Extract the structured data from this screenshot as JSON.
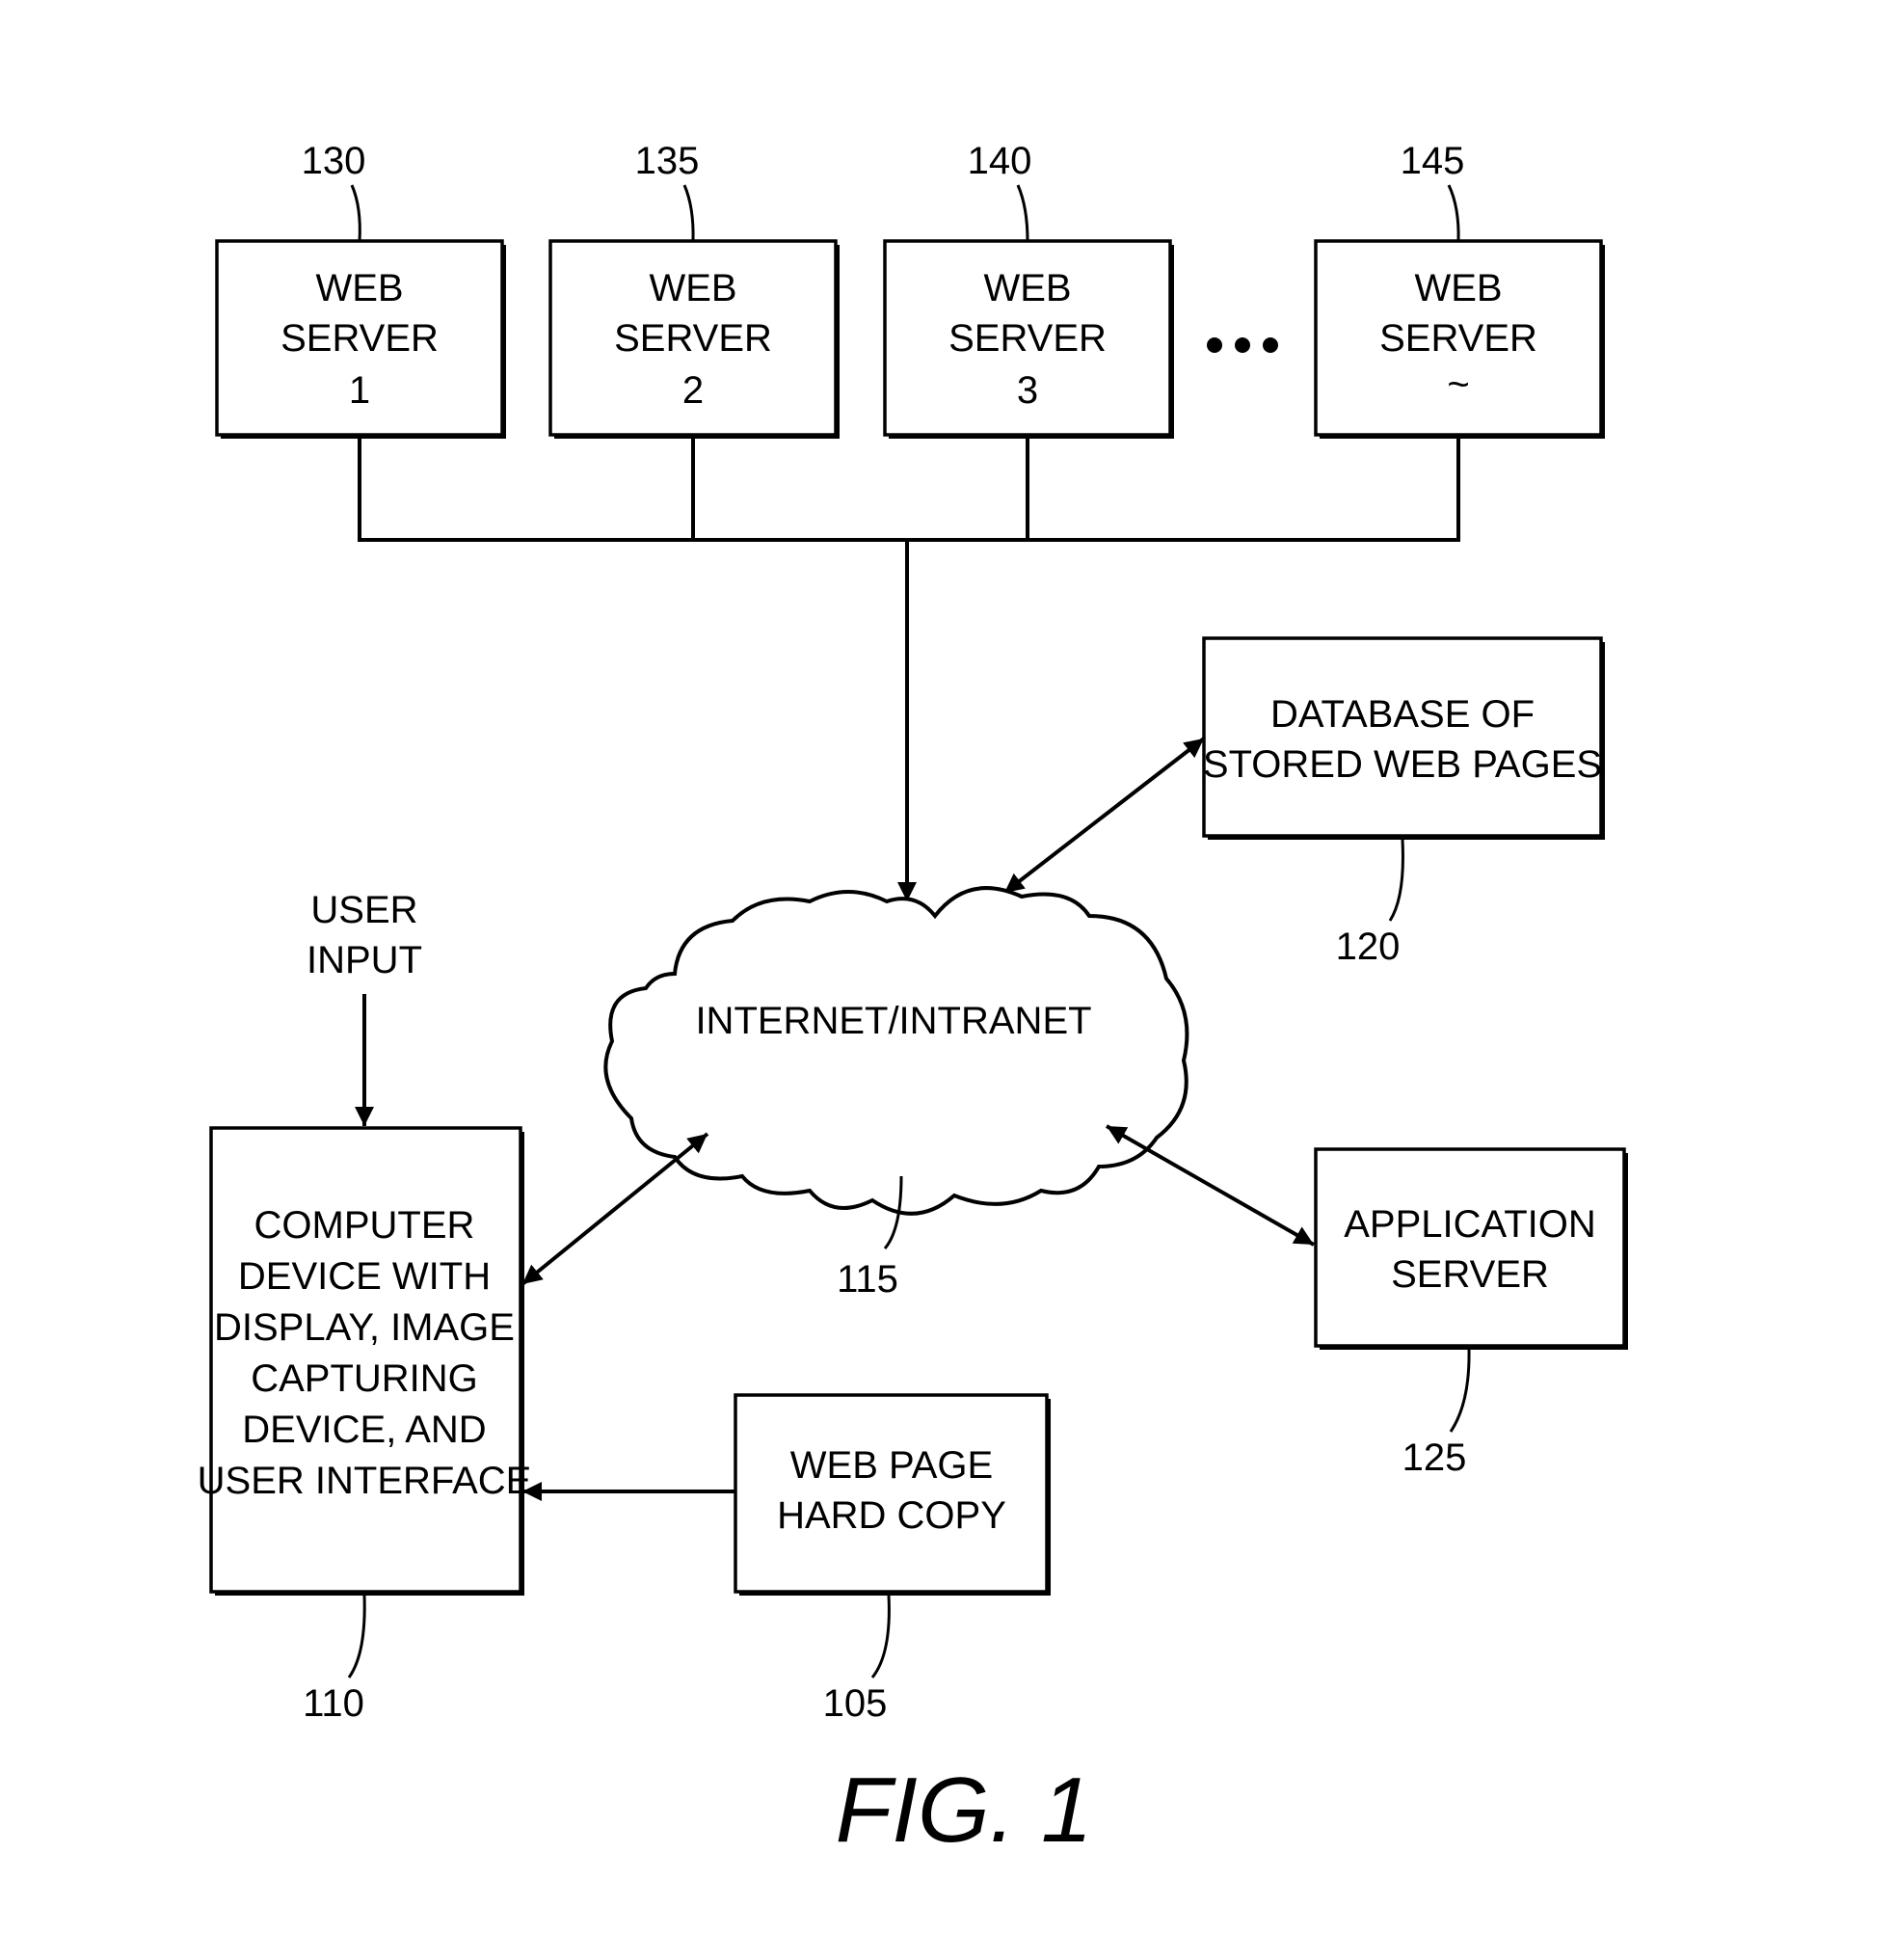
{
  "figure": {
    "caption": "FIG. 1",
    "ink_color": "#000000",
    "background": "#ffffff"
  },
  "web_servers": [
    {
      "ref": "130",
      "lines": [
        "WEB",
        "SERVER",
        "1"
      ]
    },
    {
      "ref": "135",
      "lines": [
        "WEB",
        "SERVER",
        "2"
      ]
    },
    {
      "ref": "140",
      "lines": [
        "WEB",
        "SERVER",
        "3"
      ]
    },
    {
      "ref": "145",
      "lines": [
        "WEB",
        "SERVER",
        "~"
      ]
    }
  ],
  "ellipsis": "•••",
  "database": {
    "ref": "120",
    "lines": [
      "DATABASE OF",
      "STORED WEB PAGES"
    ]
  },
  "network": {
    "ref": "115",
    "label": "INTERNET/INTRANET"
  },
  "app_server": {
    "ref": "125",
    "lines": [
      "APPLICATION",
      "SERVER"
    ]
  },
  "computer": {
    "ref": "110",
    "lines": [
      "COMPUTER",
      "DEVICE WITH",
      "DISPLAY, IMAGE",
      "CAPTURING",
      "DEVICE, AND",
      "USER INTERFACE"
    ]
  },
  "hard_copy": {
    "ref": "105",
    "lines": [
      "WEB PAGE",
      "HARD COPY"
    ]
  },
  "user_input": {
    "lines": [
      "USER",
      "INPUT"
    ]
  }
}
